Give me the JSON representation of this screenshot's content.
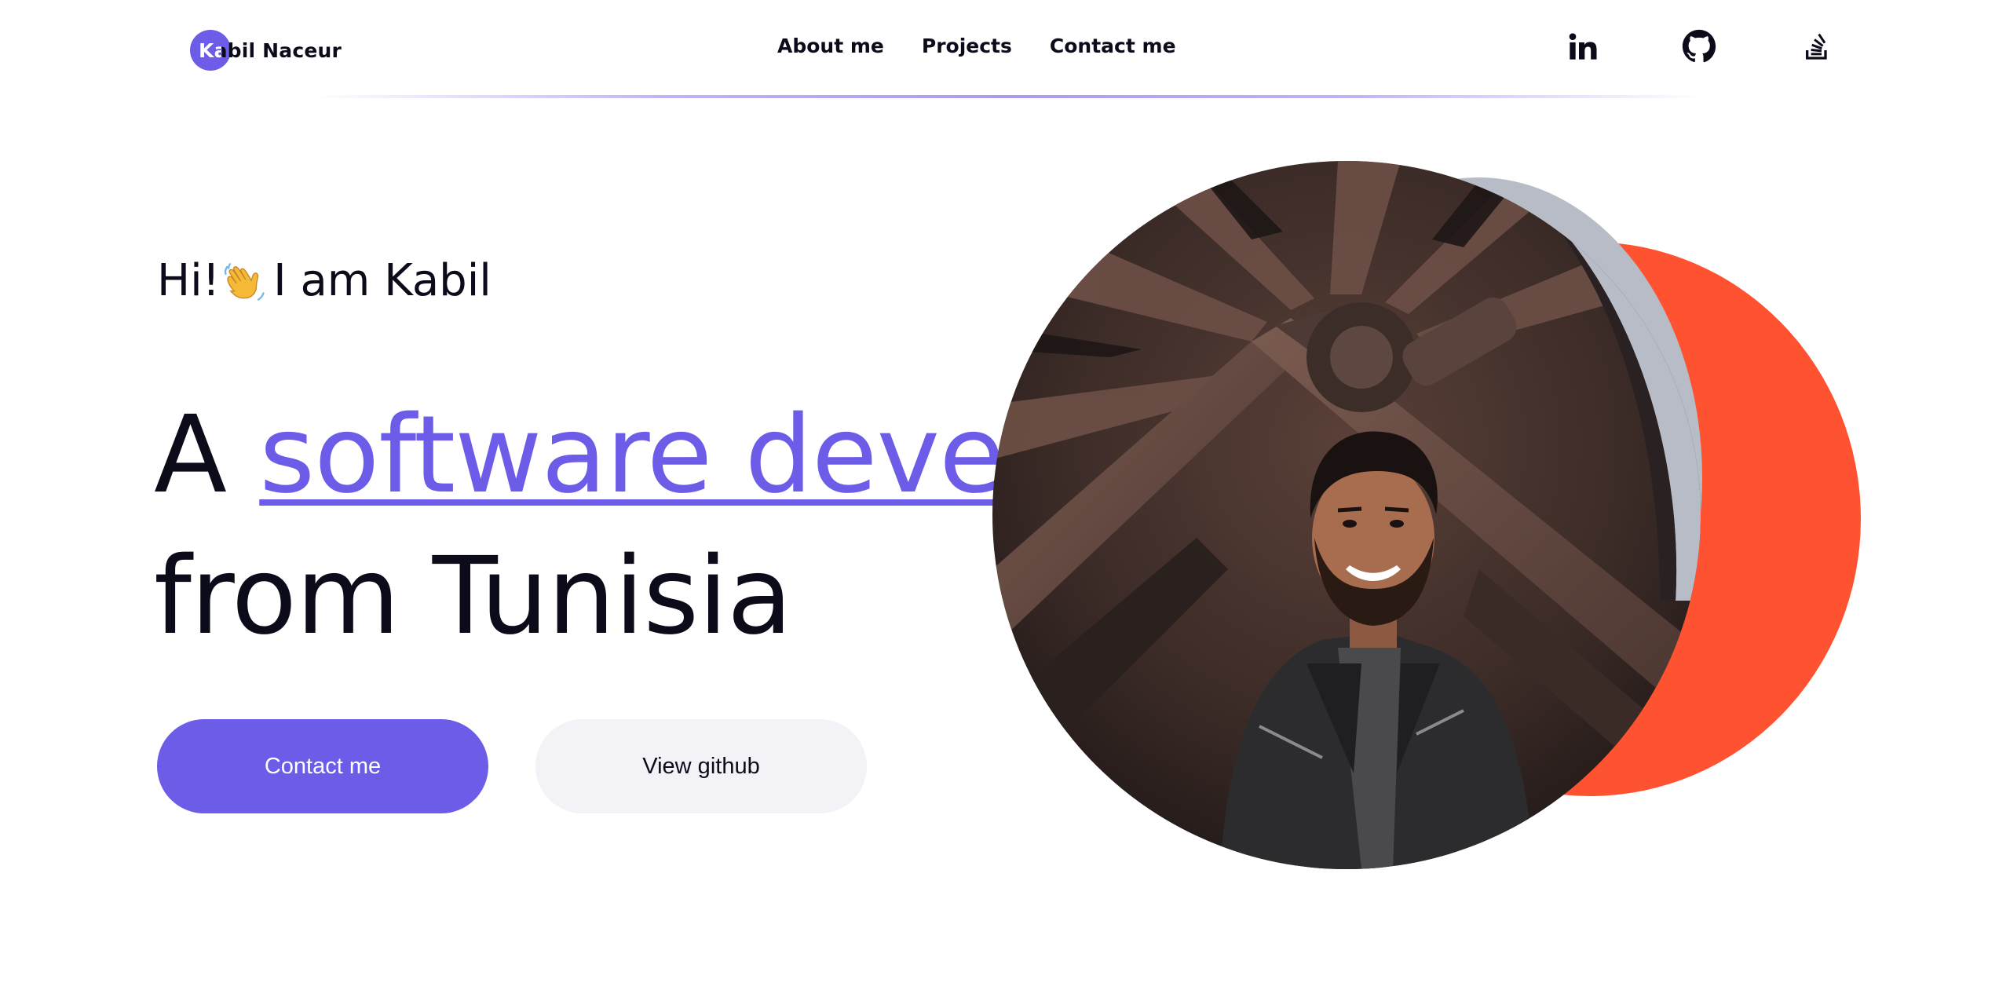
{
  "header": {
    "logo_text": "Kabil Naceur",
    "nav": {
      "about": "About me",
      "projects": "Projects",
      "contact": "Contact me"
    },
    "social_icons": [
      "linkedin-icon",
      "github-icon",
      "stackoverflow-icon"
    ]
  },
  "hero": {
    "greeting_pre": "Hi!",
    "greeting_post": "I am Kabil",
    "headline_article": "A",
    "headline_accent": "software developer",
    "headline_line2": "from Tunisia",
    "buttons": {
      "primary": "Contact me",
      "secondary": "View github"
    }
  },
  "colors": {
    "accent": "#6c5ce7",
    "orange": "#ff5230",
    "text": "#0b0b1a",
    "secondary_button": "#f2f2f7"
  }
}
